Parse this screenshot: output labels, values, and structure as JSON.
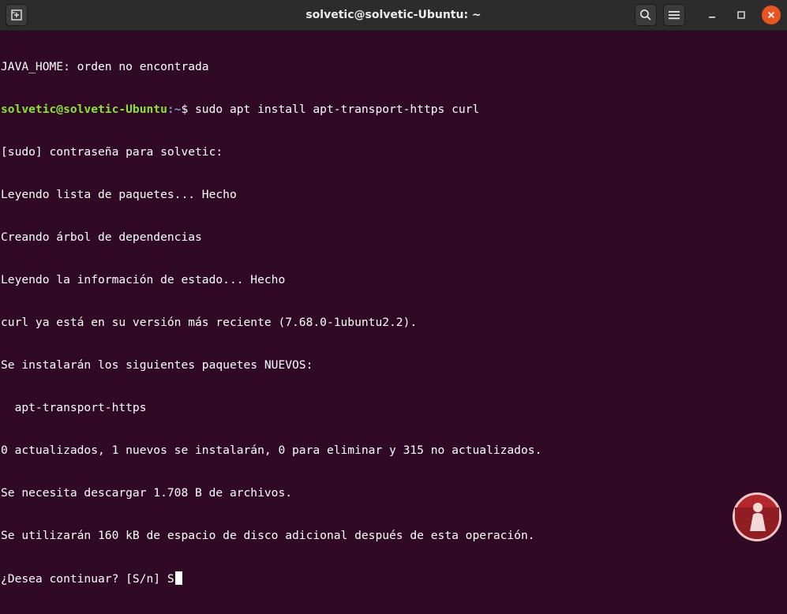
{
  "window": {
    "title": "solvetic@solvetic-Ubuntu: ~",
    "buttons": {
      "new_tab_icon": "new-tab-icon",
      "search_icon": "search-icon",
      "menu_icon": "hamburger-menu-icon",
      "minimize_icon": "minimize-icon",
      "maximize_icon": "maximize-icon",
      "close_icon": "close-icon"
    },
    "close_color": "#e95420"
  },
  "terminal": {
    "background": "#300a24",
    "user_color": "#8ae234",
    "path_color": "#729fcf",
    "line1": "JAVA_HOME: orden no encontrada",
    "prompt_user": "solvetic@solvetic-Ubuntu",
    "prompt_path": ":~",
    "prompt_command": "$ sudo apt install apt-transport-https curl",
    "lines": [
      "[sudo] contraseña para solvetic:",
      "Leyendo lista de paquetes... Hecho",
      "Creando árbol de dependencias",
      "Leyendo la información de estado... Hecho",
      "curl ya está en su versión más reciente (7.68.0-1ubuntu2.2).",
      "Se instalarán los siguientes paquetes NUEVOS:",
      "  apt-transport-https",
      "0 actualizados, 1 nuevos se instalarán, 0 para eliminar y 315 no actualizados.",
      "Se necesita descargar 1.708 B de archivos.",
      "Se utilizarán 160 kB de espacio de disco adicional después de esta operación."
    ],
    "last_line": "¿Desea continuar? [S/n] S"
  },
  "watermark": {
    "icon": "solvetic-logo-icon"
  }
}
